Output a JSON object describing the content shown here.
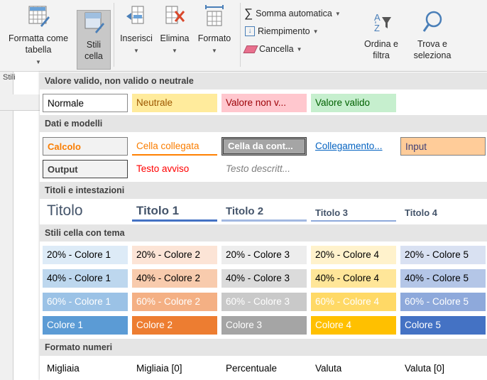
{
  "ribbon": {
    "format_table_label": "Formatta come tabella",
    "cell_styles_label": "Stili cella",
    "insert_label": "Inserisci",
    "delete_label": "Elimina",
    "format_label": "Formato",
    "autosum_label": "Somma automatica",
    "fill_label": "Riempimento",
    "clear_label": "Cancella",
    "sort_label": "Ordina e filtra",
    "find_label": "Trova e seleziona",
    "group_styles_label": "Stili"
  },
  "sections": {
    "s1": "Valore valido, non valido o neutrale",
    "s2": "Dati e modelli",
    "s3": "Titoli e intestazioni",
    "s4": "Stili cella con tema",
    "s5": "Formato numeri"
  },
  "good_bad": [
    "Normale",
    "Neutrale",
    "Valore non v...",
    "Valore valido"
  ],
  "data_models": {
    "row1": [
      "Calcolo",
      "Cella collegata",
      "Cella da cont...",
      "Collegamento...",
      "Input"
    ],
    "row2": [
      "Output",
      "Testo avviso",
      "Testo descritt..."
    ]
  },
  "titles": [
    "Titolo",
    "Titolo 1",
    "Titolo 2",
    "Titolo 3",
    "Titolo 4"
  ],
  "themed": {
    "row20": [
      "20% - Colore 1",
      "20% - Colore 2",
      "20% - Colore 3",
      "20% - Colore 4",
      "20% - Colore 5"
    ],
    "row40": [
      "40% - Colore 1",
      "40% - Colore 2",
      "40% - Colore 3",
      "40% - Colore 4",
      "40% - Colore 5"
    ],
    "row60": [
      "60% - Colore 1",
      "60% - Colore 2",
      "60% - Colore 3",
      "60% - Colore 4",
      "60% - Colore 5"
    ],
    "rowfull": [
      "Colore 1",
      "Colore 2",
      "Colore 3",
      "Colore 4",
      "Colore 5"
    ]
  },
  "number_formats": [
    "Migliaia",
    "Migliaia [0]",
    "Percentuale",
    "Valuta",
    "Valuta [0]"
  ],
  "colors": {
    "accent1": "#5b9bd5",
    "accent2": "#ed7d31",
    "accent3": "#a5a5a5",
    "accent4": "#ffc000",
    "accent5": "#4472c4"
  }
}
